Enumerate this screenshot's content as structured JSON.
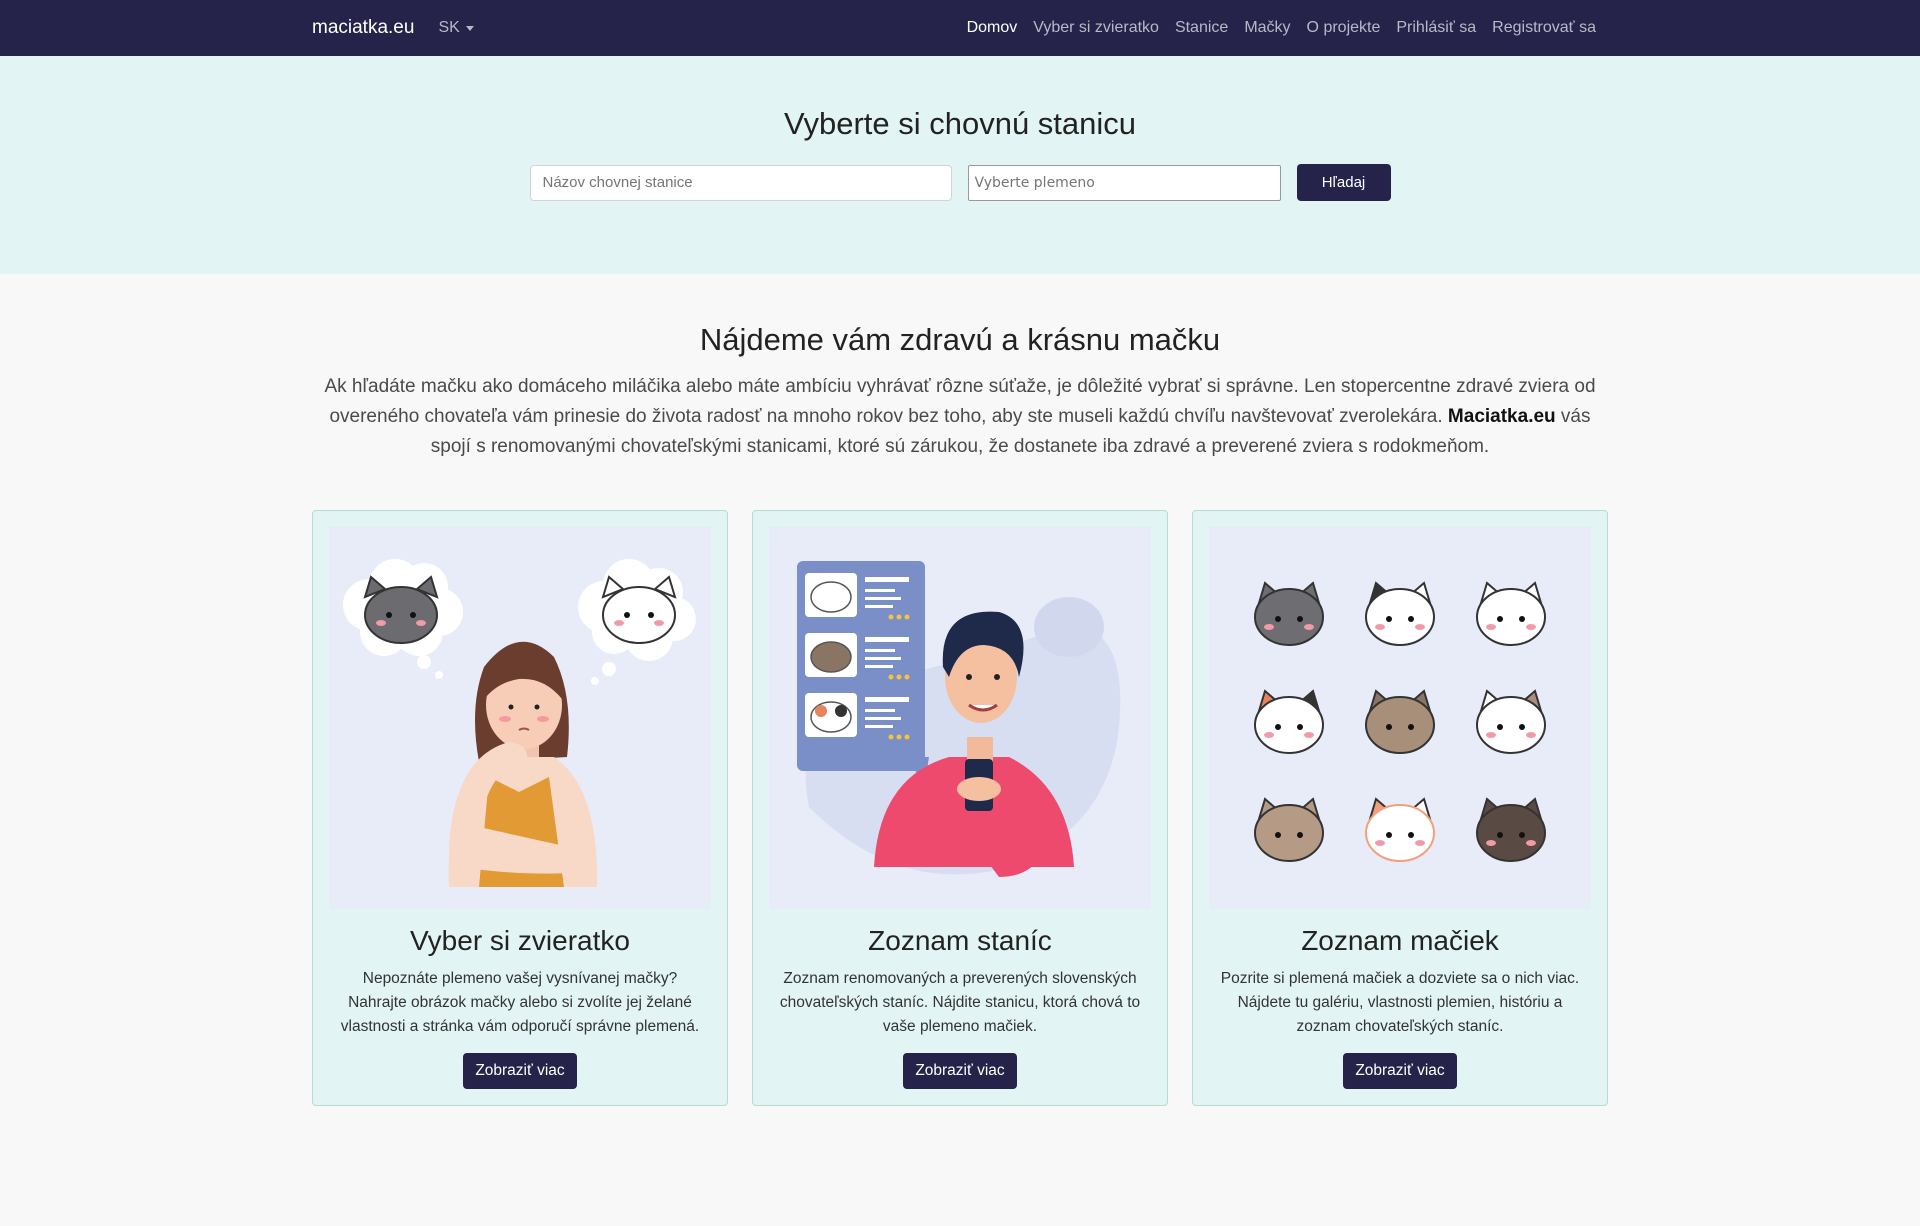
{
  "nav": {
    "brand": "maciatka.eu",
    "language": "SK",
    "links": [
      "Domov",
      "Vyber si zvieratko",
      "Stanice",
      "Mačky",
      "O projekte",
      "Prihlásiť sa",
      "Registrovať sa"
    ],
    "active": "Domov"
  },
  "hero": {
    "title": "Vyberte si chovnú stanicu",
    "name_placeholder": "Názov chovnej stanice",
    "breed_placeholder": "Vyberte plemeno",
    "search_label": "Hľadaj"
  },
  "intro": {
    "title": "Nájdeme vám zdravú a krásnu mačku",
    "text_before": "Ak hľadáte mačku ako domáceho miláčika alebo máte ambíciu vyhrávať rôzne súťaže, je dôležité vybrať si správne. Len stopercentne zdravé zviera od overeného chovateľa vám prinesie do života radosť na mnoho rokov bez toho, aby ste museli každú chvíľu navštevovať zverolekára. ",
    "brand_bold": "Maciatka.eu",
    "text_after": " vás spojí s renomovanými chovateľskými stanicami, ktoré sú zárukou, že dostanete iba zdravé a preverené zviera s rodokmeňom."
  },
  "cards": [
    {
      "title": "Vyber si zvieratko",
      "text": "Nepoznáte plemeno vašej vysnívanej mačky? Nahrajte obrázok mačky alebo si zvolíte jej želané vlastnosti a stránka vám odporučí správne plemená.",
      "button": "Zobraziť viac"
    },
    {
      "title": "Zoznam staníc",
      "text": "Zoznam renomovaných a preverených slovenských chovateľských staníc. Nájdite stanicu, ktorá chová to vaše plemeno mačiek.",
      "button": "Zobraziť viac"
    },
    {
      "title": "Zoznam mačiek",
      "text": "Pozrite si plemená mačiek a dozviete sa o nich viac. Nájdete tu galériu, vlastnosti plemien, históriu a zoznam chovateľských staníc.",
      "button": "Zobraziť viac"
    }
  ],
  "colors": {
    "navbar": "#26234a",
    "hero_bg": "#e2f4f4",
    "card_bg": "#e2f4f4",
    "button": "#26234a"
  }
}
